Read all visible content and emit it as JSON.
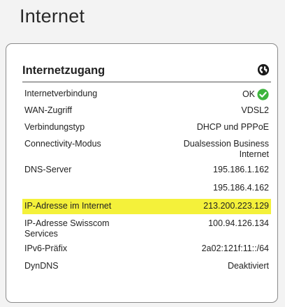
{
  "page": {
    "title": "Internet"
  },
  "card": {
    "title": "Internetzugang",
    "rows": [
      {
        "label": "Internetverbindung",
        "value": "OK"
      },
      {
        "label": "WAN-Zugriff",
        "value": "VDSL2"
      },
      {
        "label": "Verbindungstyp",
        "value": "DHCP und PPPoE"
      },
      {
        "label": "Connectivity-Modus",
        "value_line1": "Dualsession Business",
        "value_line2": "Internet"
      },
      {
        "label": "DNS-Server",
        "value": "195.186.1.162"
      },
      {
        "label": "",
        "value": "195.186.4.162"
      },
      {
        "label": "IP-Adresse im Internet",
        "value": "213.200.223.129"
      },
      {
        "label_line1": "IP-Adresse Swisscom",
        "label_line2": "Services",
        "value": "100.94.126.134"
      },
      {
        "label": "IPv6-Präfix",
        "value": "2a02:121f:11::/64"
      },
      {
        "label": "DynDNS",
        "value": "Deaktiviert"
      }
    ]
  },
  "colors": {
    "highlight": "#f4f13a",
    "ok_green": "#3cb43c"
  },
  "icons": {
    "header": "globe-icon",
    "status": "check-circle-icon"
  }
}
